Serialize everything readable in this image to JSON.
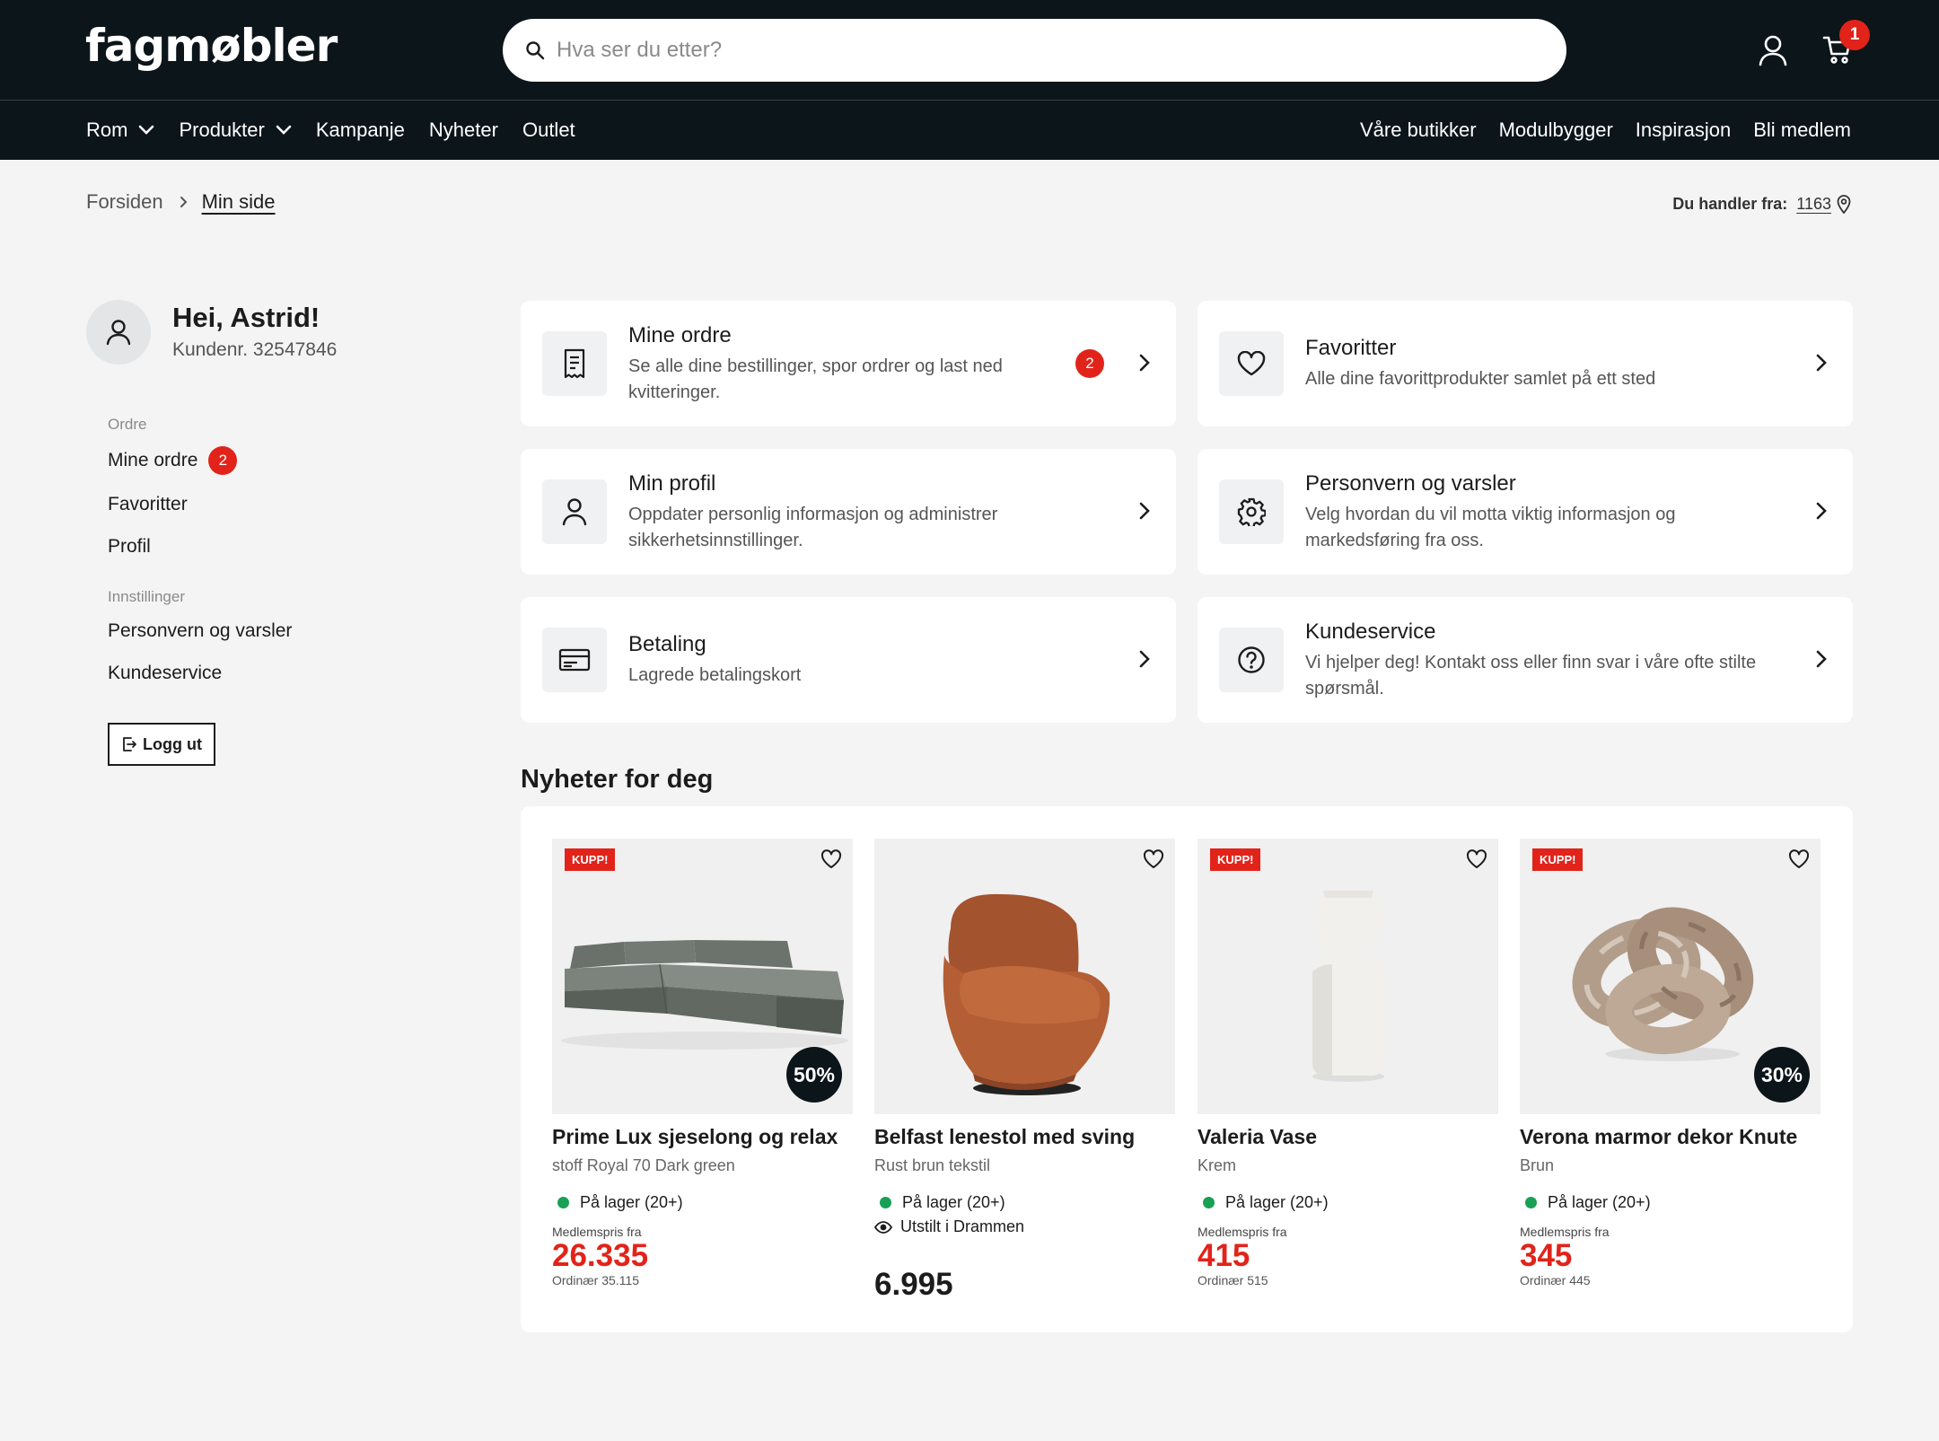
{
  "header": {
    "logo": "fagmøbler",
    "search_placeholder": "Hva ser du etter?",
    "cart_count": "1"
  },
  "nav": {
    "left": [
      {
        "label": "Rom",
        "dropdown": true
      },
      {
        "label": "Produkter",
        "dropdown": true
      },
      {
        "label": "Kampanje",
        "dropdown": false
      },
      {
        "label": "Nyheter",
        "dropdown": false
      },
      {
        "label": "Outlet",
        "dropdown": false
      }
    ],
    "right": [
      "Våre butikker",
      "Modulbygger",
      "Inspirasjon",
      "Bli medlem"
    ]
  },
  "breadcrumb": {
    "home": "Forsiden",
    "current": "Min side"
  },
  "store": {
    "label": "Du handler fra:",
    "value": "1163"
  },
  "user": {
    "greeting": "Hei, Astrid!",
    "customer_number": "Kundenr. 32547846"
  },
  "sidebar": {
    "orders_heading": "Ordre",
    "my_orders": "Mine ordre",
    "my_orders_badge": "2",
    "favorites": "Favoritter",
    "profile": "Profil",
    "settings_heading": "Innstillinger",
    "privacy": "Personvern og varsler",
    "support": "Kundeservice",
    "logout": "Logg ut"
  },
  "cards": {
    "orders": {
      "title": "Mine ordre",
      "desc": "Se alle dine bestillinger, spor ordrer og last ned kvitteringer.",
      "badge": "2"
    },
    "favorites": {
      "title": "Favoritter",
      "desc": "Alle dine favorittprodukter samlet på ett sted"
    },
    "profile": {
      "title": "Min profil",
      "desc": "Oppdater personlig informasjon og administrer sikkerhetsinnstillinger."
    },
    "privacy": {
      "title": "Personvern og varsler",
      "desc": "Velg hvordan du vil motta viktig informasjon og markedsføring fra oss."
    },
    "payment": {
      "title": "Betaling",
      "desc": "Lagrede betalingskort"
    },
    "support": {
      "title": "Kundeservice",
      "desc": "Vi hjelper deg! Kontakt oss eller finn svar i våre ofte stilte spørsmål."
    }
  },
  "news": {
    "title": "Nyheter for deg",
    "kuppi_label": "KUPP!",
    "member_label": "Medlemspris fra",
    "products": [
      {
        "name": "Prime Lux sjeselong og relax",
        "variant": "stoff Royal 70 Dark green",
        "stock": "På lager (20+)",
        "discount": "50%",
        "price": "26.335",
        "ordinary": "Ordinær 35.115"
      },
      {
        "name": "Belfast lenestol med sving",
        "variant": "Rust brun tekstil",
        "stock": "På lager (20+)",
        "showroom": "Utstilt i Drammen",
        "price": "6.995"
      },
      {
        "name": "Valeria Vase",
        "variant": "Krem",
        "stock": "På lager (20+)",
        "price": "415",
        "ordinary": "Ordinær 515"
      },
      {
        "name": "Verona marmor dekor Knute",
        "variant": "Brun",
        "stock": "På lager (20+)",
        "discount": "30%",
        "price": "345",
        "ordinary": "Ordinær 445"
      }
    ]
  },
  "colors": {
    "dark": "#0c151a",
    "accent_red": "#e2231a",
    "stock_green": "#18a054",
    "background": "#f4f4f4"
  }
}
